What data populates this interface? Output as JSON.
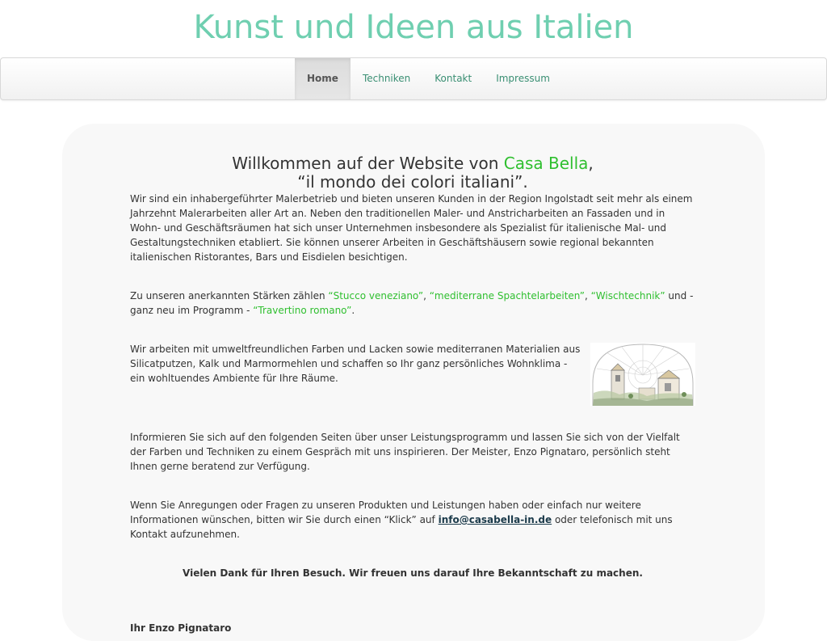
{
  "site": {
    "title": "Kunst und Ideen aus Italien"
  },
  "nav": {
    "items": [
      {
        "label": "Home"
      },
      {
        "label": "Techniken"
      },
      {
        "label": "Kontakt"
      },
      {
        "label": "Impressum"
      }
    ]
  },
  "content": {
    "welcome_prefix": "Willkommen auf der Website von ",
    "brand": "Casa Bella",
    "welcome_comma": ",",
    "welcome_line2": "“il mondo dei colori italiani”.",
    "p1": "Wir sind ein inhabergeführter Malerbetrieb und bieten unseren Kunden in der Region Ingolstadt seit mehr als einem Jahrzehnt Malerarbeiten aller Art an. Neben den traditionellen Maler- und Anstricharbeiten an Fassaden und in Wohn- und Geschäftsräumen hat sich unser Unternehmen insbesondere als Spezialist für italienische Mal- und Gestaltungstechniken etabliert. Sie können unserer Arbeiten in Geschäftshäusern sowie regional bekannten italienischen Ristorantes, Bars und Eisdielen besichtigen.",
    "p2_intro": "Zu unseren anerkannten Stärken zählen ",
    "p2_t1": "“Stucco veneziano”",
    "p2_sep1": ", ",
    "p2_t2": "“mediterrane Spachtelarbeiten”",
    "p2_sep2": ", ",
    "p2_t3": "“Wischtechnik”",
    "p2_mid": " und - ganz neu im Programm - ",
    "p2_t4": "“Travertino romano”",
    "p2_end": ".",
    "p3": "Wir arbeiten mit umweltfreundlichen Farben und Lacken sowie mediterranen Materialien aus Silicatputzen, Kalk und Marmormehlen und schaffen so Ihr ganz persönliches Wohnklima - ein wohltuendes Ambiente für Ihre Räume.",
    "p4": "Informieren Sie sich auf den folgenden Seiten über unser Leistungsprogramm und lassen Sie sich von der Vielfalt der Farben und Techniken zu einem Gespräch mit uns inspirieren. Der Meister, Enzo Pignataro, persönlich steht Ihnen gerne beratend zur Verfügung.",
    "p5_a": "Wenn Sie Anregungen oder Fragen zu unseren Produkten und Leistungen haben oder einfach nur weitere Informationen wünschen, bitten wir Sie durch einen “Klick” auf ",
    "email": "info@casabella-in.de",
    "p5_b": " oder telefonisch mit uns Kontakt aufzunehmen.",
    "thanks": "Vielen Dank für Ihren Besuch. Wir freuen uns darauf Ihre Bekanntschaft zu machen.",
    "signature": "Ihr Enzo Pignataro"
  },
  "colors": {
    "title": "#6fcfb0",
    "nav_link": "#3a8f73",
    "accent": "#2fbf2f",
    "link": "#1b3a4a",
    "panel": "#f8f8f8"
  }
}
